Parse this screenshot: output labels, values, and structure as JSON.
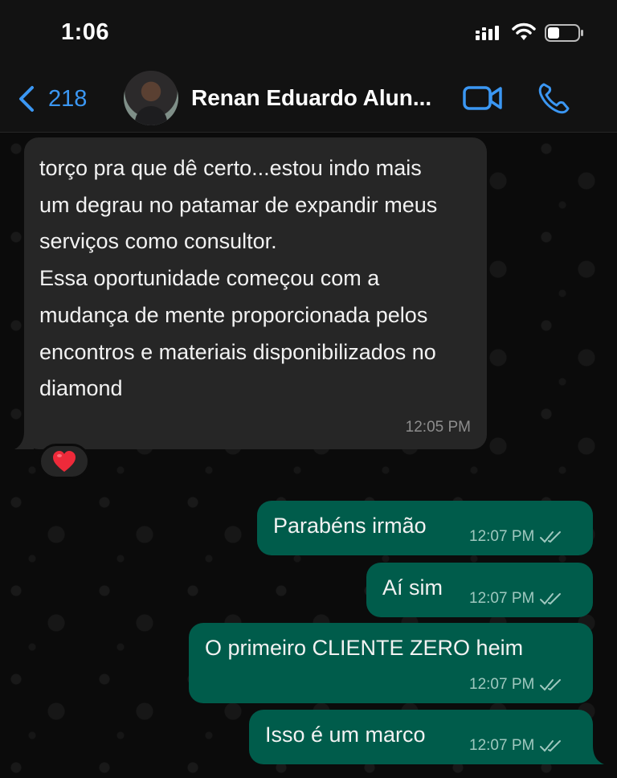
{
  "status_bar": {
    "time": "1:06"
  },
  "header": {
    "back_count": "218",
    "contact_name": "Renan Eduardo Alun..."
  },
  "incoming": {
    "text": "torço pra que dê certo...estou indo mais um degrau no patamar de expandir meus serviços como consultor.\nEssa oportunidade começou com a mudança de mente proporcionada pelos encontros e materiais disponibilizados no diamond",
    "time": "12:05 PM",
    "reaction": "❤️"
  },
  "outgoing": [
    {
      "text": "Parabéns irmão",
      "time": "12:07 PM"
    },
    {
      "text": "Aí sim",
      "time": "12:07 PM"
    },
    {
      "text": "O primeiro CLIENTE ZERO heim",
      "time": "12:07 PM"
    },
    {
      "text": "Isso é um marco",
      "time": "12:07 PM"
    }
  ],
  "colors": {
    "accent": "#3b97f3",
    "outgoing_bubble": "#005c4b",
    "incoming_bubble": "#262626",
    "background": "#0b0b0b"
  }
}
